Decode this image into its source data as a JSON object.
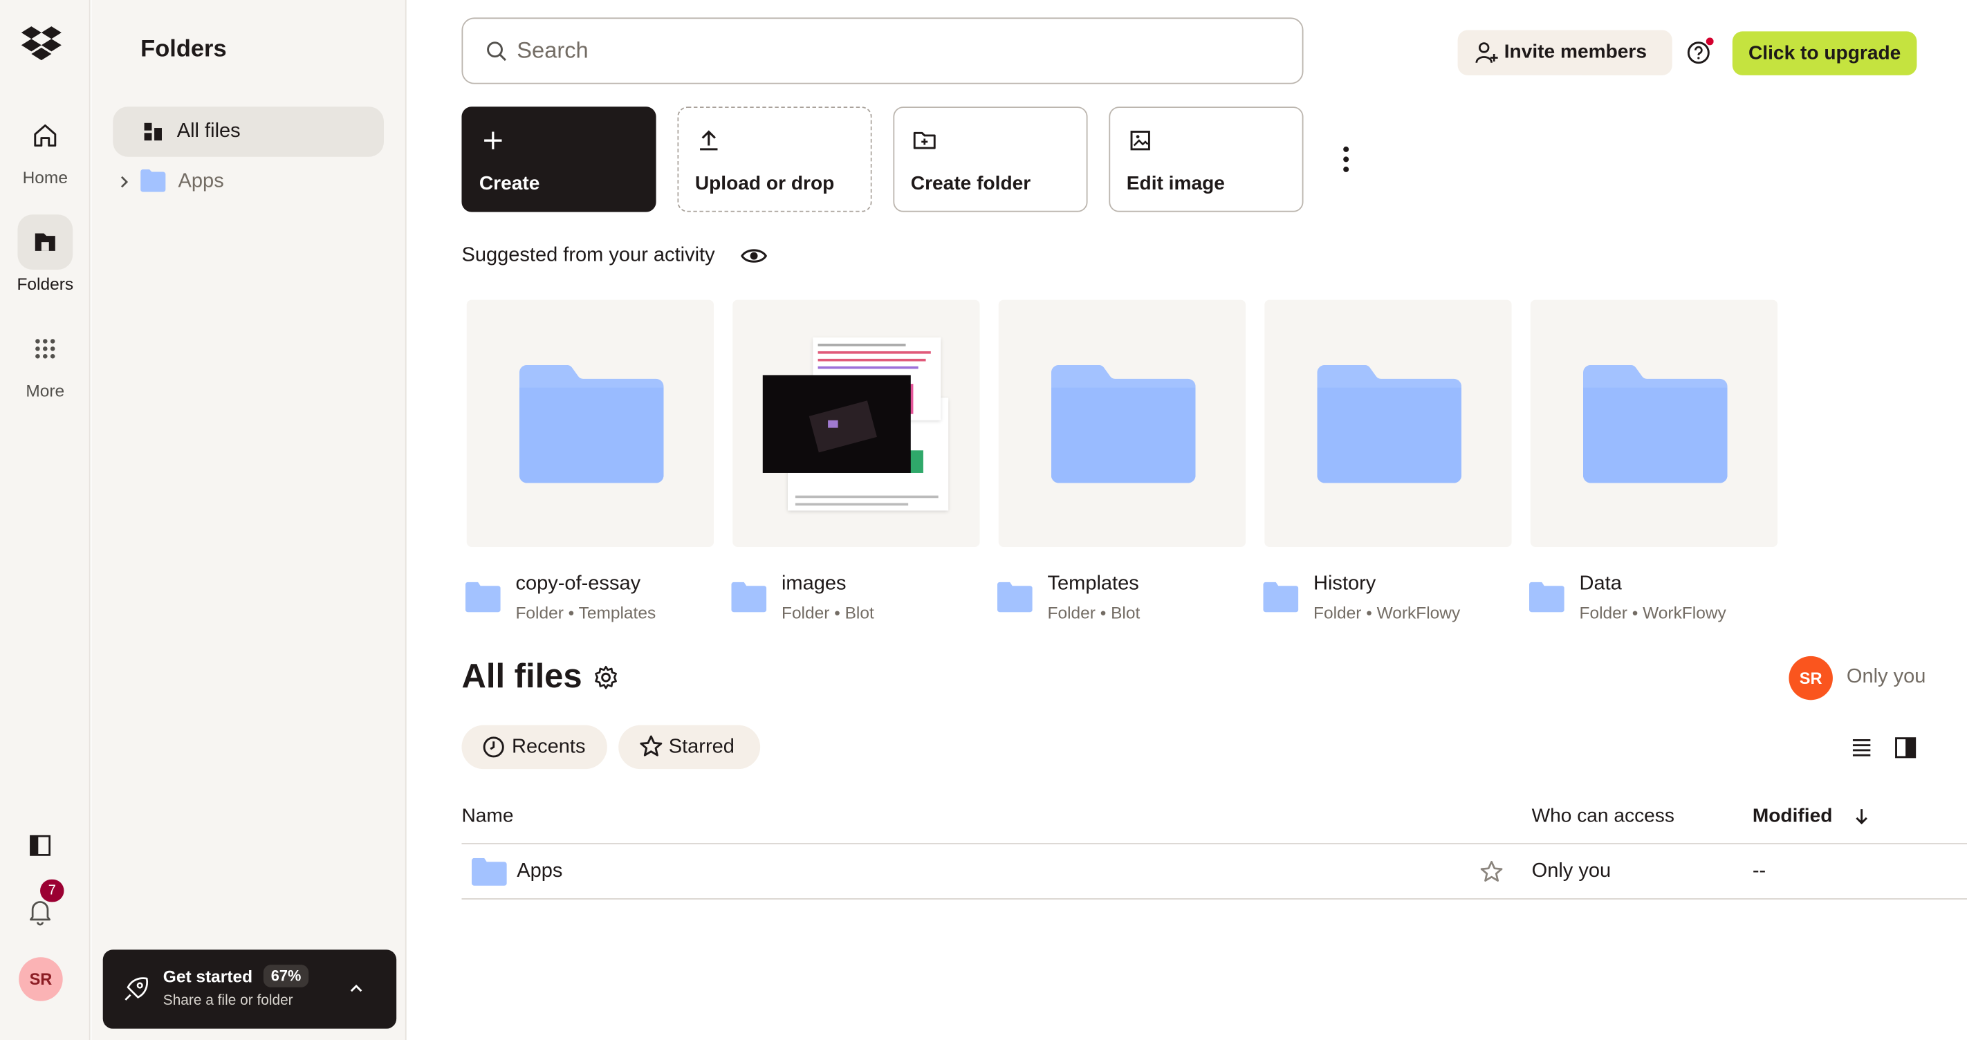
{
  "rail": {
    "items": [
      {
        "label": "Home",
        "icon": "home-icon"
      },
      {
        "label": "Folders",
        "icon": "folders-icon"
      },
      {
        "label": "More",
        "icon": "grid-icon"
      }
    ],
    "notification_count": "7",
    "avatar_initials": "SR"
  },
  "panel": {
    "title": "Folders",
    "all_files": "All files",
    "apps": "Apps",
    "get_started": {
      "title": "Get started",
      "percent": "67%",
      "subtitle": "Share a file or folder"
    }
  },
  "search": {
    "placeholder": "Search"
  },
  "header": {
    "invite": "Invite members",
    "upgrade": "Click to upgrade"
  },
  "actions": {
    "create": "Create",
    "upload": "Upload or drop",
    "create_folder": "Create folder",
    "edit_image": "Edit image"
  },
  "suggested": {
    "title": "Suggested from your activity",
    "items": [
      {
        "name": "copy-of-essay",
        "meta": "Folder • Templates"
      },
      {
        "name": "images",
        "meta": "Folder • Blot"
      },
      {
        "name": "Templates",
        "meta": "Folder • Blot"
      },
      {
        "name": "History",
        "meta": "Folder • WorkFlowy"
      },
      {
        "name": "Data",
        "meta": "Folder • WorkFlowy"
      }
    ]
  },
  "all_files": {
    "title": "All files",
    "owner_initials": "SR",
    "owner_label": "Only you",
    "filters": {
      "recents": "Recents",
      "starred": "Starred"
    },
    "columns": {
      "name": "Name",
      "access": "Who can access",
      "modified": "Modified"
    },
    "rows": [
      {
        "name": "Apps",
        "access": "Only you",
        "modified": "--"
      }
    ]
  },
  "colors": {
    "folder": "#a3c2ff",
    "upgrade": "#c5e33f",
    "dark": "#1e1919",
    "avatar": "#fa551e"
  }
}
